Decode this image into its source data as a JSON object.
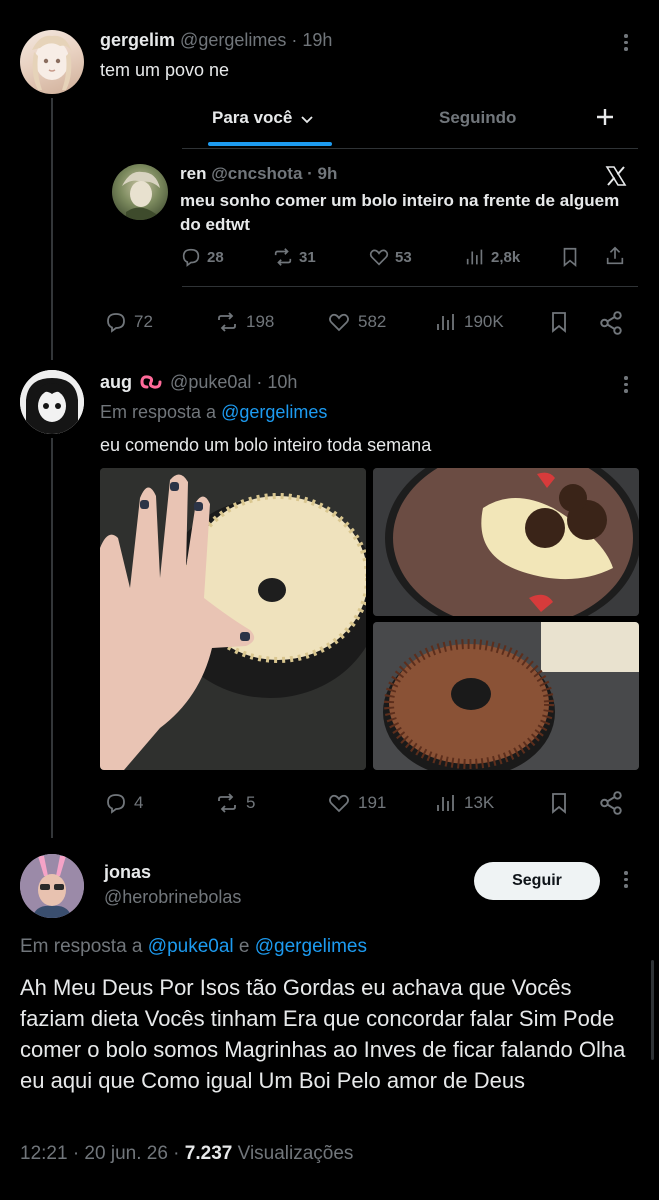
{
  "tweet1": {
    "name": "gergelim",
    "handle": "@gergelimes",
    "time": "· 19h",
    "text": "tem um povo ne",
    "embedded": {
      "tabs": {
        "for_you": "Para você",
        "following": "Seguindo"
      },
      "inner": {
        "name": "ren",
        "handle": "@cncshota",
        "time": "· 9h",
        "text": "meu sonho comer um bolo inteiro na frente de alguem do edtwt",
        "replies": "28",
        "reposts": "31",
        "likes": "53",
        "views": "2,8k"
      }
    },
    "replies": "72",
    "reposts": "198",
    "likes": "582",
    "views": "190K"
  },
  "tweet2": {
    "name": "aug",
    "handle": "@puke0al",
    "time": "· 10h",
    "reply_prefix": "Em resposta a",
    "reply_to": "@gergelimes",
    "text": "eu comendo um bolo inteiro toda semana",
    "replies": "4",
    "reposts": "5",
    "likes": "191",
    "views": "13K"
  },
  "tweet3": {
    "name": "jonas",
    "handle": "@herobrinebolas",
    "follow_label": "Seguir",
    "reply_prefix": "Em resposta a",
    "reply_to_1": "@puke0al",
    "reply_and": "e",
    "reply_to_2": "@gergelimes",
    "text": "Ah Meu Deus Por Isos tão Gordas eu achava que Vocês faziam dieta Vocês tinham Era que concordar falar Sim Pode comer o bolo somos Magrinhas ao Inves de ficar falando Olha eu aqui que Como igual Um Boi Pelo amor de Deus",
    "timestamp": "12:21 · 20 jun. 26 ·",
    "view_count": "7.237",
    "views_label": "Visualizações"
  },
  "colors": {
    "accent": "#1d9bf0",
    "muted": "#71767b",
    "background": "#000000",
    "text": "#e7e9ea"
  }
}
